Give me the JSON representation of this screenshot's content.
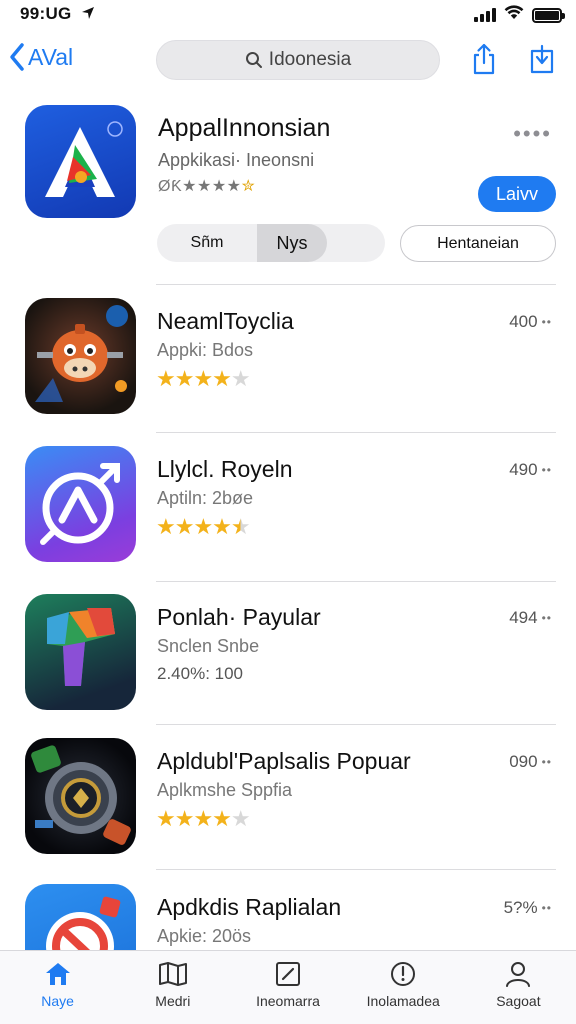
{
  "status": {
    "time": "99:UG"
  },
  "nav": {
    "back_label": "AVal",
    "search_text": "Idoonesia"
  },
  "featured": {
    "title": "AppalInnonsian",
    "subtitle": "Appkikasi· Ineonsni",
    "rating_prefix": "ØƘ",
    "rating_gray": "★★★★",
    "rating_gold": "✮",
    "get_label": "Laivv",
    "seg_left": "Sñm",
    "seg_right": "Nys",
    "outline_label": "Hentaneian"
  },
  "apps": [
    {
      "title": "NeamlToyclia",
      "subtitle": "Appki: Bdos",
      "rating": 4,
      "price": "400"
    },
    {
      "title": "Llylcl. Royeln",
      "subtitle": "Aptiln: 2bøe",
      "rating": 4.5,
      "price": "490"
    },
    {
      "title": "Ponlah· Payular",
      "subtitle": "Snclen Snbe",
      "meta": "2.40%: 100",
      "price": "494"
    },
    {
      "title": "Apldubl'Paplsalis Popuar",
      "subtitle": "Aplkmshe Sppfia",
      "rating": 4,
      "price": "090"
    },
    {
      "title": "Apdkdis Raplialan",
      "subtitle": "Apkie: 20ös",
      "price": "5?%"
    }
  ],
  "tabs": [
    {
      "label": "Naye",
      "icon": "home-icon",
      "active": true
    },
    {
      "label": "Medri",
      "icon": "map-icon"
    },
    {
      "label": "Ineomarra",
      "icon": "edit-icon"
    },
    {
      "label": "Inolamadea",
      "icon": "alert-circle-icon"
    },
    {
      "label": "Sagoat",
      "icon": "person-icon"
    }
  ],
  "colors": {
    "accent": "#1f7bf1",
    "star": "#f3b21b"
  }
}
